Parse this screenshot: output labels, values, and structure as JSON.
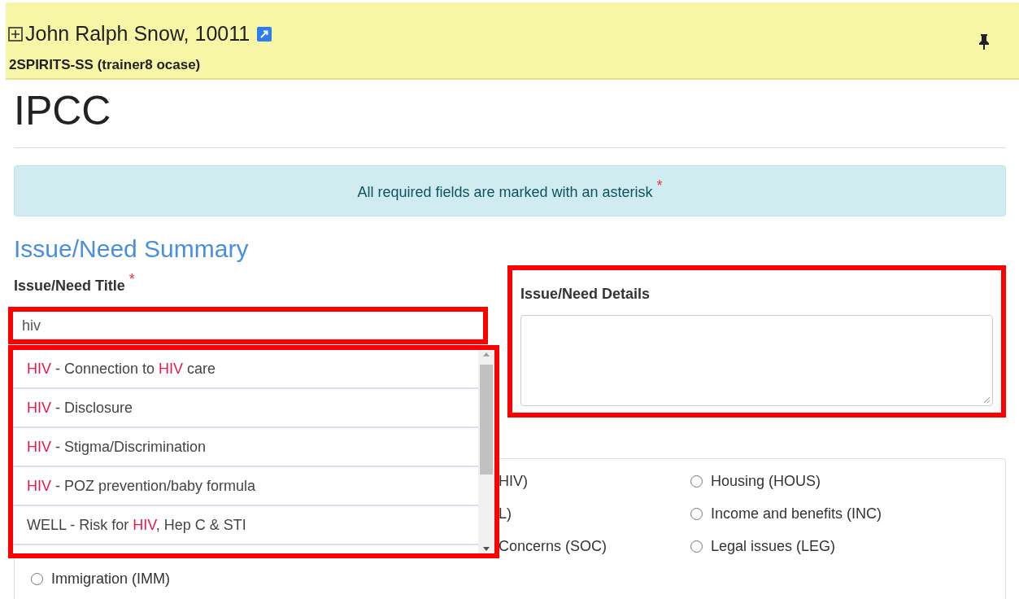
{
  "client_header": {
    "name": "John Ralph Snow, 10011",
    "subtitle": "2SPIRITS-SS (trainer8 ocase)"
  },
  "page_title": "IPCC",
  "alert": {
    "text": "All required fields are marked with an asterisk",
    "asterisk": "*"
  },
  "section_title": "Issue/Need Summary",
  "title_field": {
    "label": "Issue/Need Title",
    "asterisk": "*",
    "value": "hiv",
    "highlighted": true
  },
  "suggestions": [
    {
      "selected": false,
      "parts": [
        {
          "text": "HIV",
          "match": true
        },
        {
          "text": " - Connection to ",
          "match": false
        },
        {
          "text": "HIV",
          "match": true
        },
        {
          "text": " care",
          "match": false
        }
      ]
    },
    {
      "selected": false,
      "parts": [
        {
          "text": "HIV",
          "match": true
        },
        {
          "text": " - Disclosure",
          "match": false
        }
      ]
    },
    {
      "selected": false,
      "parts": [
        {
          "text": "HIV",
          "match": true
        },
        {
          "text": " - Stigma/Discrimination",
          "match": false
        }
      ]
    },
    {
      "selected": false,
      "parts": [
        {
          "text": "HIV",
          "match": true
        },
        {
          "text": " - POZ prevention/baby formula",
          "match": false
        }
      ]
    },
    {
      "selected": false,
      "parts": [
        {
          "text": "WELL - Risk for ",
          "match": false
        },
        {
          "text": "HIV",
          "match": true
        },
        {
          "text": ", Hep C & STI",
          "match": false
        }
      ]
    }
  ],
  "suggestions_highlighted": true,
  "details_field": {
    "label": "Issue/Need Details",
    "highlighted": true
  },
  "partially_hidden_labels": [
    "HIV)",
    "L)",
    "Concerns (SOC)"
  ],
  "radio_options": [
    {
      "label": "Housing (HOUS)",
      "selected": false
    },
    {
      "label": "Income and benefits (INC)",
      "selected": false
    },
    {
      "label": "Legal issues (LEG)",
      "selected": false
    },
    {
      "label": "Immigration (IMM)",
      "selected": false
    }
  ]
}
